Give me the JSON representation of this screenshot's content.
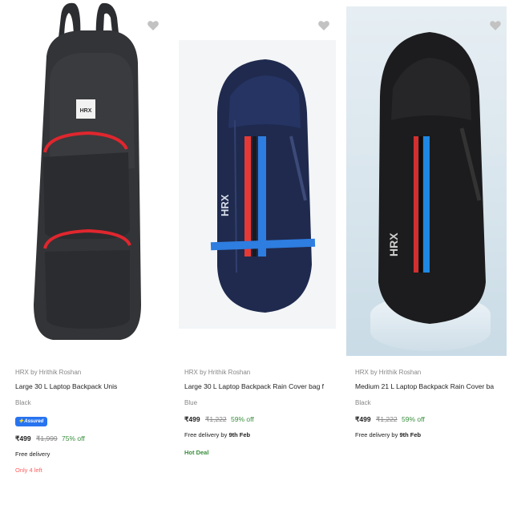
{
  "products": [
    {
      "brand": "HRX by Hrithik Roshan",
      "title": "Large 30 L Laptop Backpack Unis",
      "color": "Black",
      "assured_label": "Assured",
      "price": "₹499",
      "mrp": "₹1,999",
      "discount": "75% off",
      "delivery": "Free delivery",
      "delivery_date": "",
      "stock": "Only 4 left",
      "deal": ""
    },
    {
      "brand": "HRX by Hrithik Roshan",
      "title": "Large 30 L Laptop Backpack Rain Cover bag f",
      "color": "Blue",
      "assured_label": "",
      "price": "₹499",
      "mrp": "₹1,222",
      "discount": "59% off",
      "delivery": "Free delivery by",
      "delivery_date": "9th Feb",
      "stock": "",
      "deal": "Hot Deal"
    },
    {
      "brand": "HRX by Hrithik Roshan",
      "title": "Medium 21 L Laptop Backpack Rain Cover ba",
      "color": "Black",
      "assured_label": "",
      "price": "₹499",
      "mrp": "₹1,222",
      "discount": "59% off",
      "delivery": "Free delivery by",
      "delivery_date": "9th Feb",
      "stock": "",
      "deal": ""
    }
  ],
  "logo_text": "HRX",
  "colors": {
    "price_green": "#388e3c",
    "assured_blue": "#2874f0",
    "stock_red": "#ff6161",
    "muted_grey": "#878787"
  },
  "icons": [
    "heart-icon",
    "assured-badge"
  ]
}
